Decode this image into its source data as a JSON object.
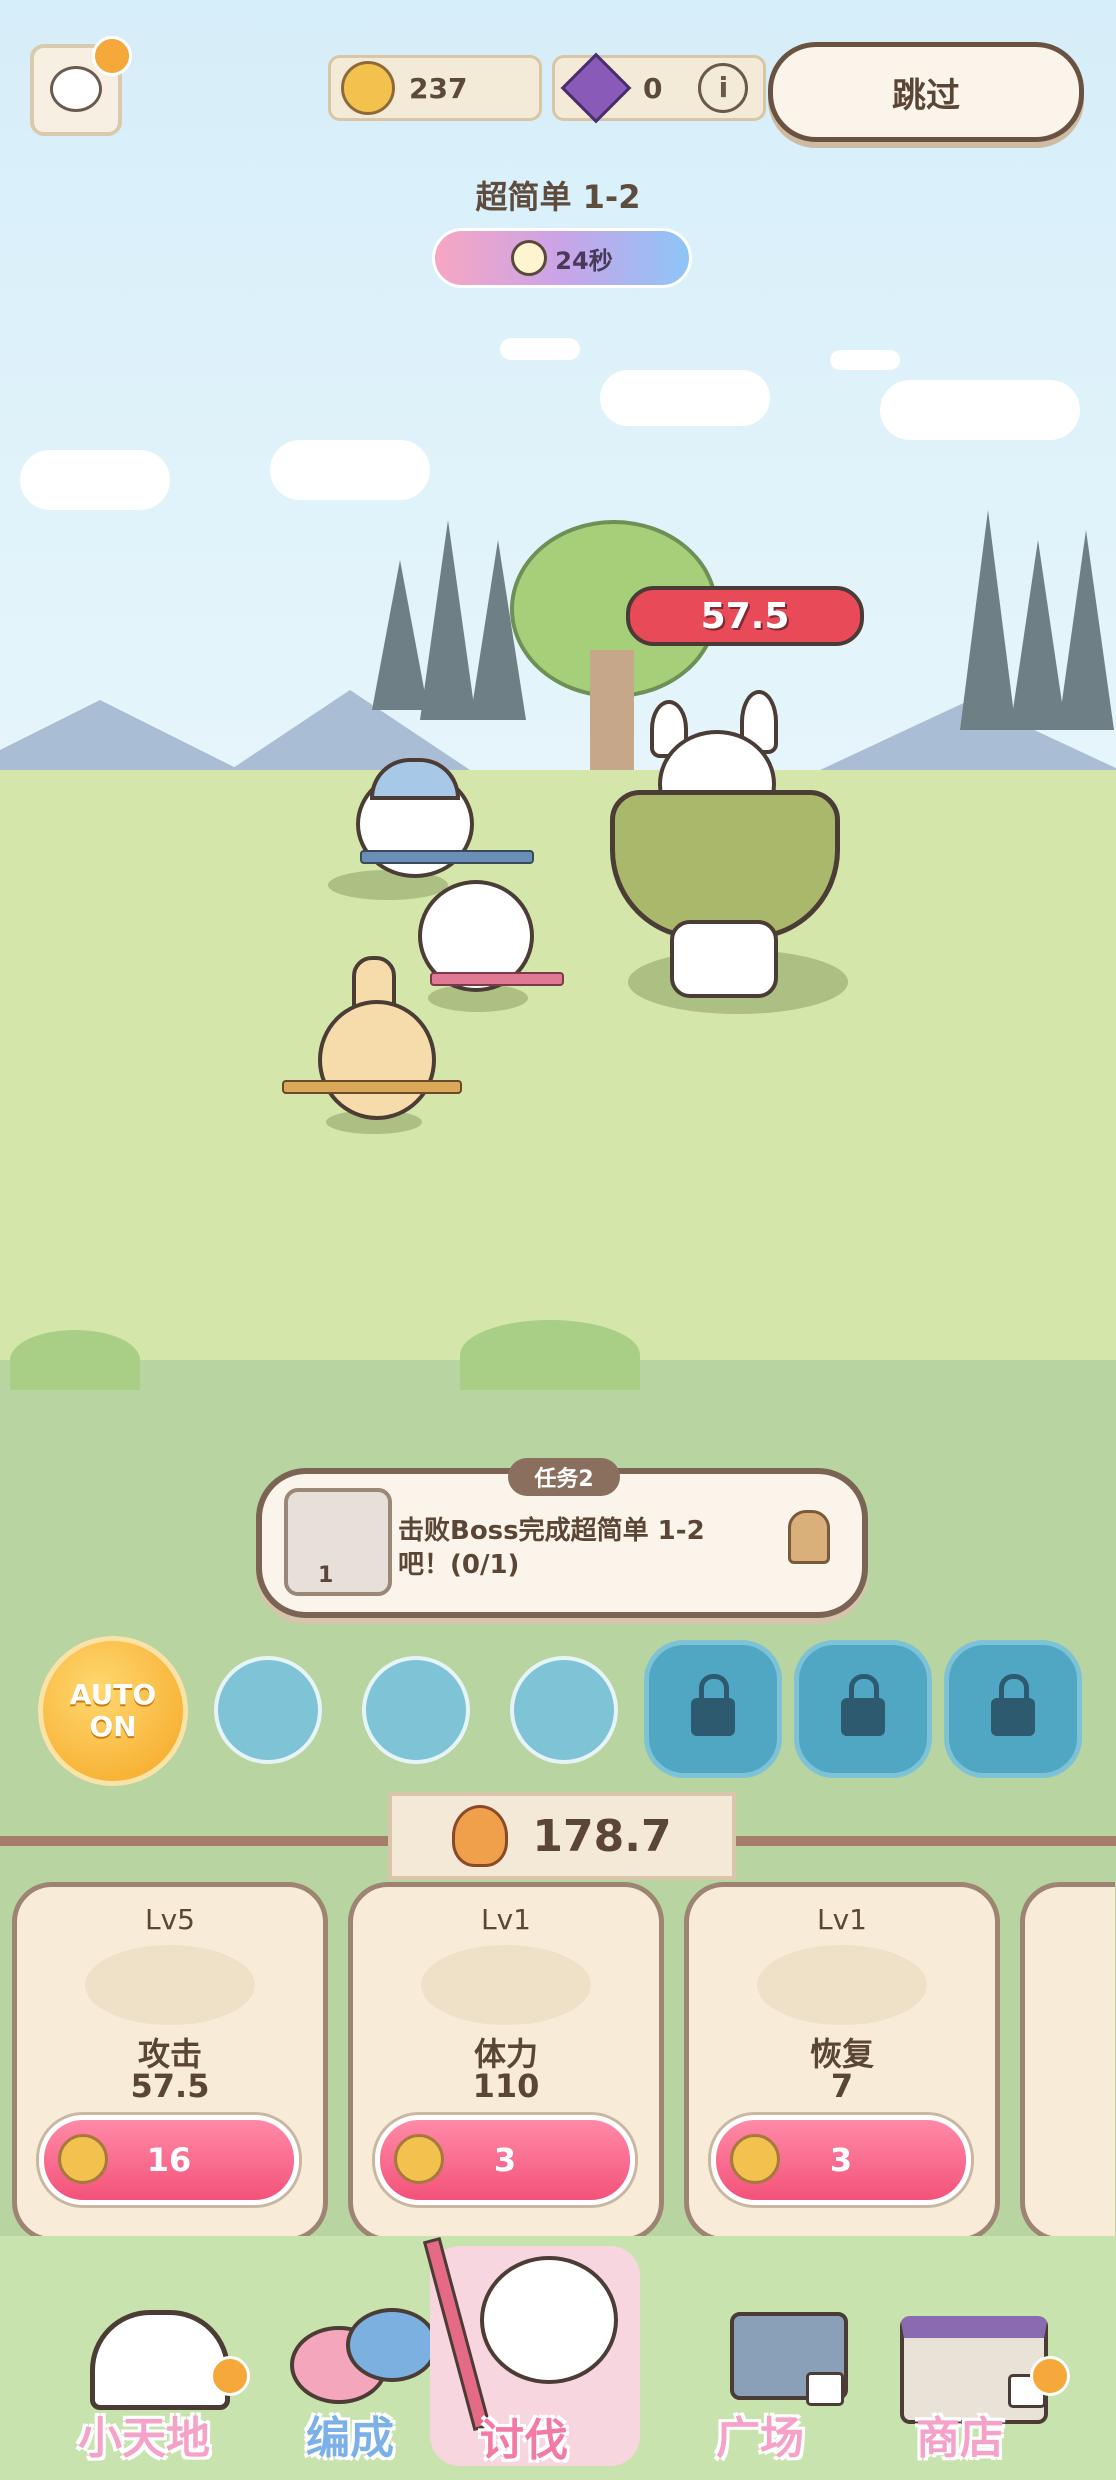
{
  "top_bar": {
    "coins": "237",
    "gems": "0",
    "skip_label": "跳过"
  },
  "stage": {
    "title": "超简单 1-2",
    "timer": "24秒"
  },
  "boss": {
    "hp": "57.5"
  },
  "mission": {
    "tag": "任务2",
    "text": "击败Boss完成超简单 1-2吧！(0/1)",
    "icon_count": "1"
  },
  "auto_button": {
    "line1": "AUTO",
    "line2": "ON"
  },
  "power": {
    "value": "178.7"
  },
  "cards": [
    {
      "level": "Lv5",
      "name": "攻击",
      "value": "57.5",
      "cost": "16"
    },
    {
      "level": "Lv1",
      "name": "体力",
      "value": "110",
      "cost": "3"
    },
    {
      "level": "Lv1",
      "name": "恢复",
      "value": "7",
      "cost": "3"
    }
  ],
  "nav": {
    "items": [
      {
        "label": "小天地"
      },
      {
        "label": "编成"
      },
      {
        "label": "讨伐"
      },
      {
        "label": "广场"
      },
      {
        "label": "商店"
      }
    ]
  },
  "colors": {
    "accent_pink": "#f4527a",
    "boss_hp_red": "#e84a58",
    "auto_orange": "#f5a623"
  }
}
